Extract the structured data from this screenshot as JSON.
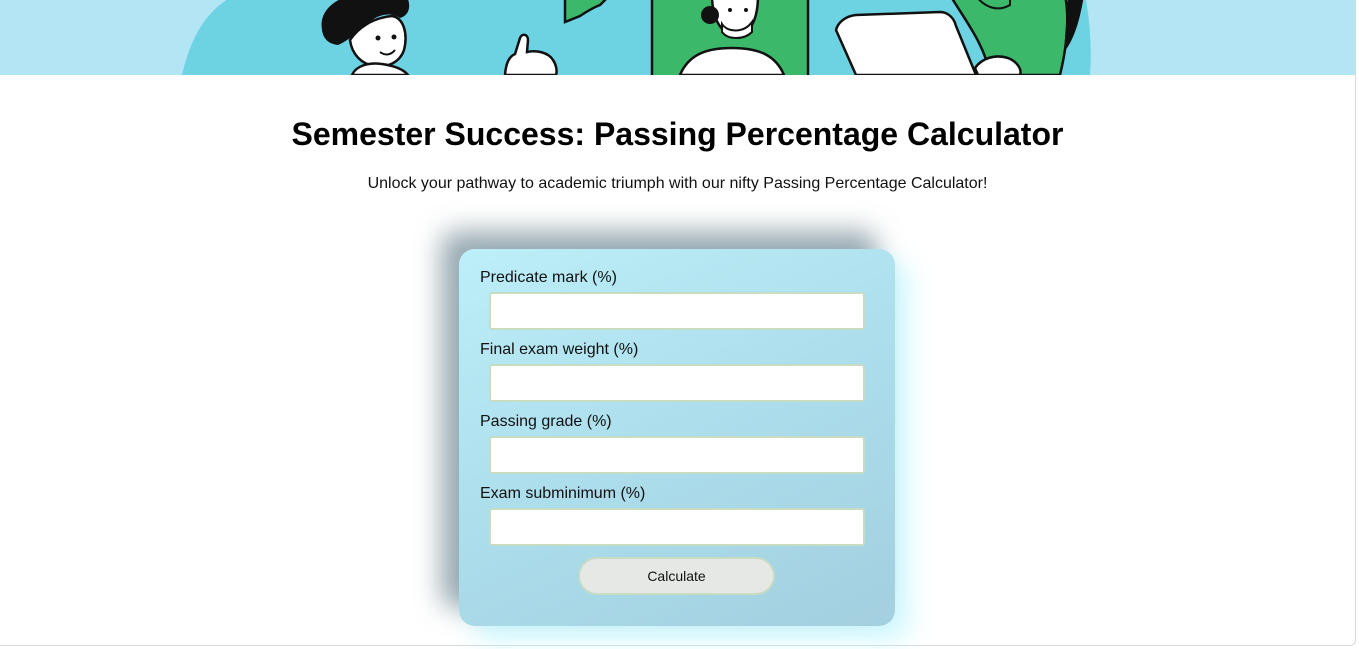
{
  "page": {
    "title": "Semester Success: Passing Percentage Calculator",
    "subtitle": "Unlock your pathway to academic triumph with our nifty Passing Percentage Calculator!"
  },
  "form": {
    "fields": [
      {
        "label": "Predicate mark (%)",
        "value": ""
      },
      {
        "label": "Final exam weight (%)",
        "value": ""
      },
      {
        "label": "Passing grade (%)",
        "value": ""
      },
      {
        "label": "Exam subminimum (%)",
        "value": ""
      }
    ],
    "calculate_label": "Calculate"
  },
  "colors": {
    "banner_background": "#b3e5f5",
    "illustration_blob": "#6dd3e3",
    "illustration_green": "#3bb86a",
    "card_gradient_start": "#bdeff9",
    "card_gradient_end": "#a3cfdf",
    "input_border": "#c6dcc3",
    "button_background": "#e6e8e6"
  }
}
